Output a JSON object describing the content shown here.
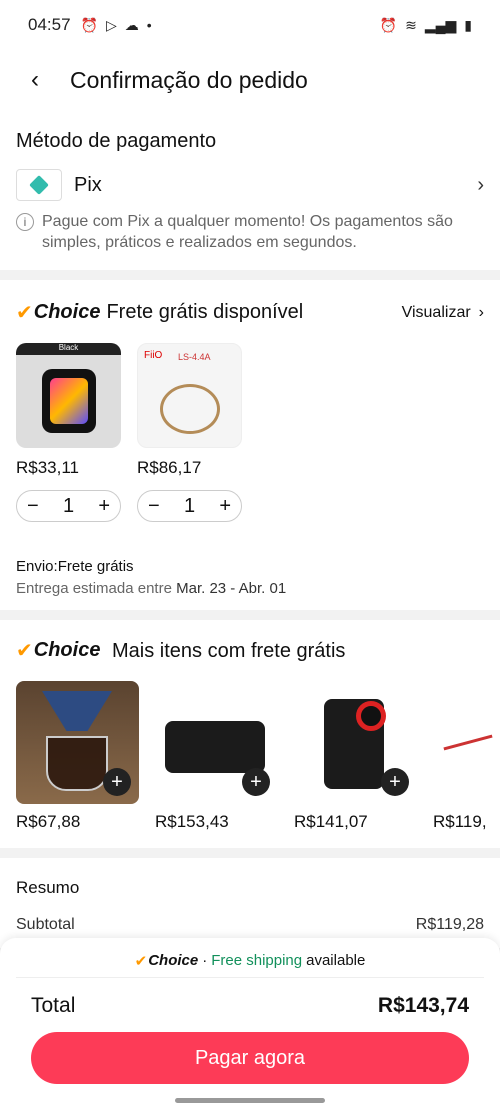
{
  "status": {
    "time": "04:57"
  },
  "header": {
    "title": "Confirmação do pedido"
  },
  "payment": {
    "section_title": "Método de pagamento",
    "method_name": "Pix",
    "info": "Pague com Pix a qualquer momento! Os pagamentos são simples, práticos e realizados em segundos."
  },
  "choice_word": "Choice",
  "shipping": {
    "title": "Frete grátis disponível",
    "view_label": "Visualizar",
    "products": [
      {
        "price": "R$33,11",
        "qty": "1",
        "tag": "Black"
      },
      {
        "price": "R$86,17",
        "qty": "1",
        "brand": "FiiO",
        "model": "LS-4.4A"
      }
    ],
    "delivery_label": "Envio:Frete grátis",
    "estimate_prefix": "Entrega estimada entre",
    "estimate_dates": "Mar. 23 - Abr. 01"
  },
  "more": {
    "title": "Mais itens com frete grátis",
    "items": [
      {
        "price": "R$67,88"
      },
      {
        "price": "R$153,43"
      },
      {
        "price": "R$141,07"
      },
      {
        "price": "R$119,"
      }
    ]
  },
  "summary": {
    "title": "Resumo",
    "subtotal_label": "Subtotal",
    "subtotal_value": "R$119,28"
  },
  "bottom": {
    "banner_sep": "·",
    "banner_green": "Free shipping",
    "banner_tail": "available",
    "total_label": "Total",
    "total_value": "R$143,74",
    "pay_button": "Pagar agora"
  },
  "colors": {
    "accent": "#fd3b57",
    "choice_check": "#ff9900",
    "green": "#12905b",
    "pix": "#32bcad"
  },
  "icons": [
    "back-arrow-icon",
    "chevron-right-icon",
    "info-icon",
    "plus-icon",
    "minus-icon",
    "pix-icon"
  ]
}
